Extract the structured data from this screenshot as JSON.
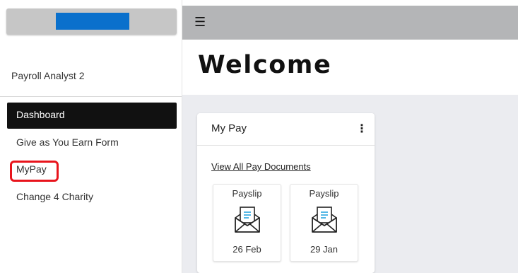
{
  "sidebar": {
    "user_name": "Payroll Analyst 2",
    "nav_items": [
      {
        "label": "Dashboard",
        "active": true
      },
      {
        "label": "Give as You Earn Form",
        "active": false
      },
      {
        "label": "MyPay",
        "active": false,
        "highlighted": true
      },
      {
        "label": "Change 4 Charity",
        "active": false
      }
    ]
  },
  "topbar": {
    "menu_icon": "hamburger-icon"
  },
  "page": {
    "title": "Welcome"
  },
  "card": {
    "title": "My Pay",
    "menu_icon": "more-vertical-icon",
    "link_label": "View All Pay Documents",
    "documents": [
      {
        "type": "Payslip",
        "date": "26 Feb",
        "icon": "open-envelope-document-icon"
      },
      {
        "type": "Payslip",
        "date": "29 Jan",
        "icon": "open-envelope-document-icon"
      }
    ]
  },
  "colors": {
    "logo_blue": "#0a70cc",
    "active_nav_bg": "#111111",
    "highlight_red": "#e8141c",
    "topbar_gray": "#b4b5b7",
    "content_bg": "#ebecf0",
    "icon_accent": "#2aa6df"
  }
}
